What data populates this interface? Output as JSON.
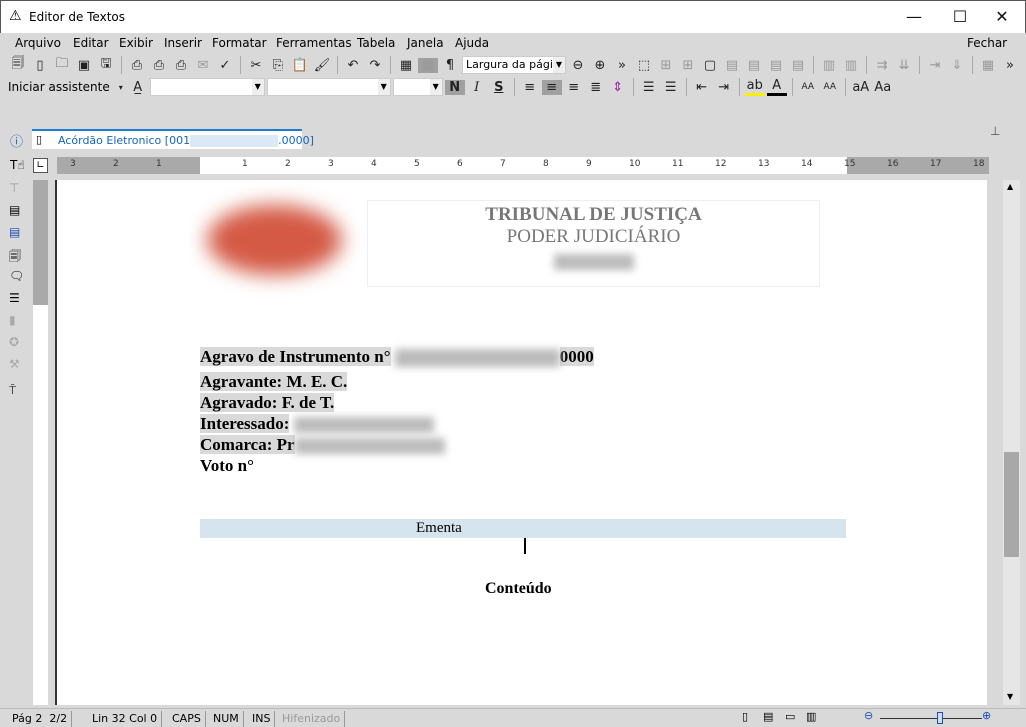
{
  "window": {
    "title": "Editor de Textos",
    "minimize": "—",
    "maximize": "☐",
    "close": "✕"
  },
  "menu": {
    "items": [
      "Arquivo",
      "Editar",
      "Exibir",
      "Inserir",
      "Formatar",
      "Ferramentas",
      "Tabela",
      "Janela",
      "Ajuda"
    ],
    "close_label": "Fechar"
  },
  "toolbar": {
    "zoom_select": "Largura da págin",
    "wizard_label": "Iniciar assistente",
    "bold": "N",
    "italic": "I",
    "strike": "S"
  },
  "tab": {
    "label_start": "Acórdão Eletronico [001",
    "label_end": ".0000]"
  },
  "ruler": {
    "left": [
      "3",
      "2",
      "1"
    ],
    "right": [
      "1",
      "2",
      "3",
      "4",
      "5",
      "6",
      "7",
      "8",
      "9",
      "10",
      "11",
      "12",
      "13",
      "14",
      "15",
      "16",
      "17",
      "18"
    ]
  },
  "document": {
    "header_title": "TRIBUNAL DE JUSTIÇA",
    "header_subtitle": "PODER JUDICIÁRIO",
    "agravo_label": "Agravo de Instrumento n°",
    "agravo_suffix": "0000",
    "agravante": "Agravante: M. E. C.",
    "agravado": "Agravado: F. de T.",
    "interessado": "Interessado:",
    "comarca": "Comarca: Pr",
    "voto": "Voto n°",
    "ementa": "Ementa",
    "conteudo": "Conteúdo"
  },
  "status": {
    "page": "Pág 2",
    "pages": "2/2",
    "line_col": "Lin 32  Col 0",
    "caps": "CAPS",
    "num": "NUM",
    "ins": "INS",
    "hyphen": "Hifenizado"
  },
  "zoom": {
    "level_fraction": 0.6
  },
  "colors": {
    "accent": "#1e7bd4",
    "ementa_bg": "#d6e4ee"
  }
}
